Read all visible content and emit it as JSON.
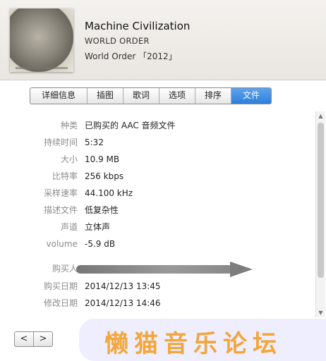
{
  "header": {
    "title": "Machine Civilization",
    "artist": "WORLD ORDER",
    "album": "World Order 「2012」"
  },
  "tabs": [
    {
      "label": "详细信息",
      "active": false
    },
    {
      "label": "插图",
      "active": false
    },
    {
      "label": "歌词",
      "active": false
    },
    {
      "label": "选项",
      "active": false
    },
    {
      "label": "排序",
      "active": false
    },
    {
      "label": "文件",
      "active": true
    }
  ],
  "file_info": [
    {
      "label": "种类",
      "value": "已购买的 AAC 音频文件"
    },
    {
      "label": "持续时间",
      "value": "5:32"
    },
    {
      "label": "大小",
      "value": "10.9 MB"
    },
    {
      "label": "比特率",
      "value": "256 kbps"
    },
    {
      "label": "采样速率",
      "value": "44.100 kHz"
    },
    {
      "label": "描述文件",
      "value": "低复杂性"
    },
    {
      "label": "声道",
      "value": "立体声"
    },
    {
      "label": "volume",
      "value": "-5.9 dB"
    },
    {
      "label": "购买人",
      "value": ""
    },
    {
      "label": "购买日期",
      "value": "2014/12/13 13:45"
    },
    {
      "label": "修改日期",
      "value": "2014/12/13 14:46"
    }
  ],
  "nav": {
    "prev": "<",
    "next": ">"
  },
  "watermark": "懒猫音乐论坛",
  "colors": {
    "active_tab": "#3a8ae3",
    "watermark_text": "#f3a63b"
  }
}
